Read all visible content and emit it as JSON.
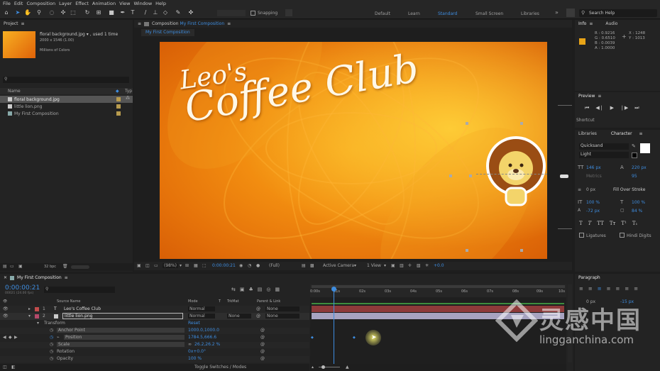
{
  "menu": [
    "File",
    "Edit",
    "Composition",
    "Layer",
    "Effect",
    "Animation",
    "View",
    "Window",
    "Help"
  ],
  "toolbar": {
    "snapping": "Snapping",
    "workspaces": [
      "Default",
      "Learn",
      "Standard",
      "Small Screen",
      "Libraries"
    ],
    "search": "Search Help"
  },
  "project": {
    "title": "Project",
    "asset_name": "floral background.jpg",
    "used": ", used 1 time",
    "asset_dims": "2000 x 1546 (1.00)",
    "asset_colors": "Millions of Colors",
    "col_name": "Name",
    "col_type": "Typ",
    "items": [
      "floral background.jpg",
      "little lion.png",
      "My First Composition"
    ],
    "bpc": "32 bpc"
  },
  "composition": {
    "tab_prefix": "Composition",
    "tab_name": "My First Composition",
    "subtab": "My First Composition",
    "title_line1": "Leo's",
    "title_line2": "Coffee Club",
    "zoom": "(98%)",
    "timecode": "0:00:00:21",
    "quality": "(Full)",
    "camera": "Active Camera",
    "views": "1 View",
    "exposure": "+0.0"
  },
  "info": {
    "tab": "Info",
    "tab2": "Audio",
    "r": "R : 0.9216",
    "g": "G : 0.6510",
    "b": "B : 0.0039",
    "a": "A : 1.0000",
    "x": "X : 1248",
    "y": "Y : 1013",
    "accent": "#e8a417"
  },
  "preview": {
    "tab": "Preview"
  },
  "shortcut": {
    "label": "Shortcut"
  },
  "libraries": {
    "tab": "Libraries"
  },
  "character": {
    "tab": "Character",
    "font": "Quicksand",
    "style": "Light",
    "size": "146 px",
    "leading": "220 px",
    "kerning": "Metrics",
    "tracking": "95",
    "stroke": "0 px",
    "stroke_mode": "Fill Over Stroke",
    "vscale": "100 %",
    "hscale": "100 %",
    "baseline": "-72 px",
    "tsume": "84 %",
    "ligatures": "Ligatures",
    "hindi": "Hindi Digits"
  },
  "paragraph": {
    "tab": "Paragraph",
    "v1": "0 px",
    "v2": "-15 px"
  },
  "timeline": {
    "comp": "My First Composition",
    "timecode": "0:00:00:21",
    "fps": "00021 (24.00 fps)",
    "col_source": "Source Name",
    "col_mode": "Mode",
    "col_t": "T",
    "col_trkmat": "TrkMat",
    "col_parent": "Parent & Link",
    "layers": [
      {
        "num": "1",
        "name": "Leo's Coffee Club",
        "mode": "Normal",
        "trkmat": "",
        "parent": "None",
        "color": "#c24c4c"
      },
      {
        "num": "2",
        "name": "little lion.png",
        "mode": "Normal",
        "trkmat": "None",
        "parent": "None",
        "color": "#b54a6a"
      }
    ],
    "transform": "Transform",
    "reset": "Reset",
    "props": [
      {
        "name": "Anchor Point",
        "value": "1000.0,1000.0"
      },
      {
        "name": "Position",
        "value": "1784.5,666.6"
      },
      {
        "name": "Scale",
        "value": "26.2,26.2 %"
      },
      {
        "name": "Rotation",
        "value": "0x+0.0°"
      },
      {
        "name": "Opacity",
        "value": "100 %"
      }
    ],
    "ticks": [
      "0:00s",
      "01s",
      "02s",
      "03s",
      "04s",
      "05s",
      "06s",
      "07s",
      "08s",
      "09s",
      "10s"
    ],
    "toggle": "Toggle Switches / Modes"
  },
  "watermark": {
    "cn": "灵感中国",
    "url": "lingganchina.com"
  }
}
